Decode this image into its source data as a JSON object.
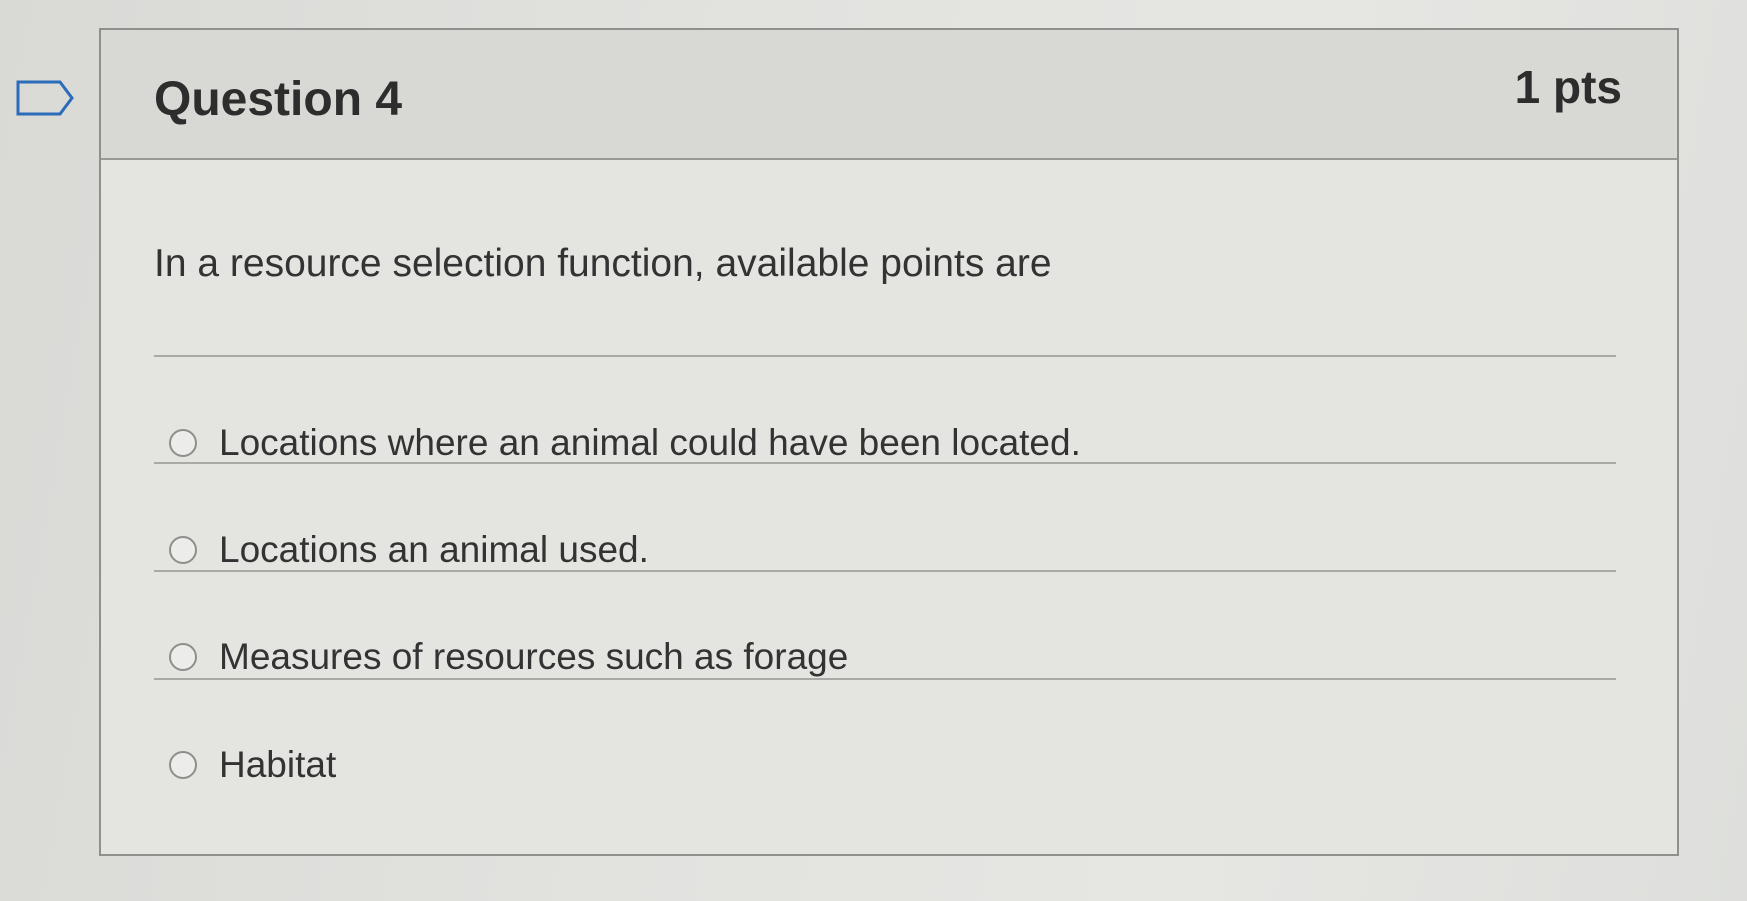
{
  "question": {
    "title": "Question 4",
    "points": "1 pts",
    "text": "In a resource selection function, available points are",
    "flag_icon": "flag-icon"
  },
  "answers": [
    {
      "label": "Locations where an animal could have been located.",
      "selected": false
    },
    {
      "label": "Locations an animal used.",
      "selected": false
    },
    {
      "label": "Measures of resources such as forage",
      "selected": false
    },
    {
      "label": "Habitat",
      "selected": false
    }
  ],
  "colors": {
    "border": "#8f8f8c",
    "header_bg": "#d8d8d5",
    "text": "#333333"
  }
}
